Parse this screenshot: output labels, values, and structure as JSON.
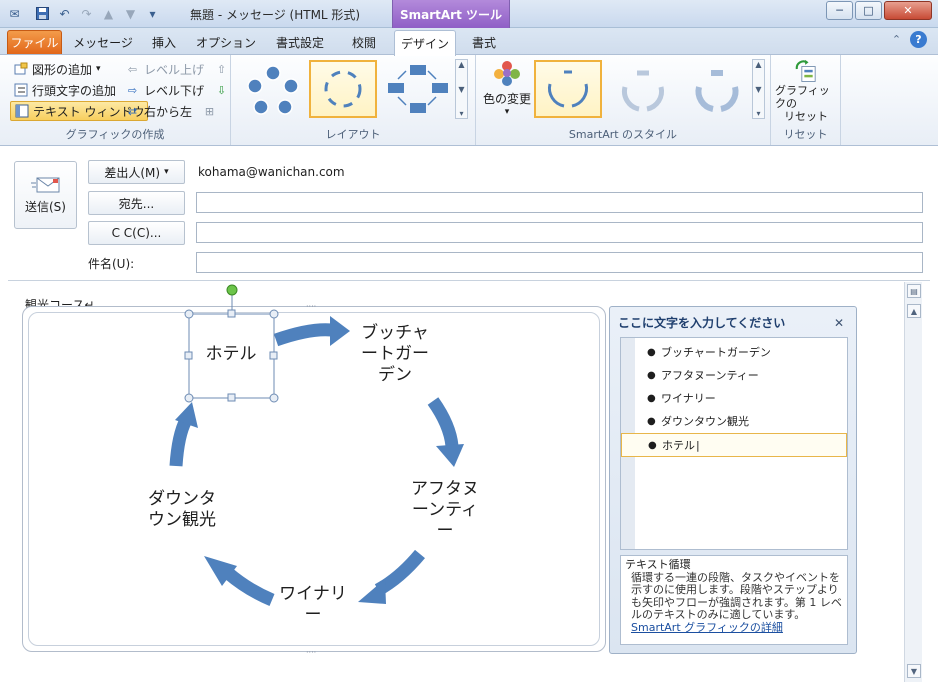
{
  "window": {
    "title": "無題 - メッセージ (HTML 形式)",
    "context_tab_header": "SmartArt ツール",
    "buttons": {
      "minimize": "─",
      "maximize": "□",
      "close": "✕"
    }
  },
  "ribbon_tabs": {
    "file": "ファイル",
    "message": "メッセージ",
    "insert": "挿入",
    "options": "オプション",
    "format_text": "書式設定",
    "review": "校閲",
    "design": "デザイン",
    "format": "書式"
  },
  "ribbon": {
    "create_graphic": {
      "label": "グラフィックの作成",
      "add_shape": "図形の追加",
      "add_bullet": "行頭文字の追加",
      "text_pane": "テキスト ウィンドウ",
      "promote": "レベル上げ",
      "demote": "レベル下げ",
      "right_to_left": "右から左"
    },
    "layout": {
      "label": "レイアウト"
    },
    "styles": {
      "label": "SmartArt のスタイル",
      "change_colors": "色の変更"
    },
    "reset": {
      "label": "リセット",
      "reset_graphic_line1": "グラフィックの",
      "reset_graphic_line2": "リセット"
    }
  },
  "mail": {
    "send": "送信(S)",
    "from_button": "差出人(M)",
    "from_value": "kohama@wanichan.com",
    "to_button": "宛先...",
    "cc_button": "C C(C)...",
    "subject_label": "件名(U):",
    "to_value": "",
    "cc_value": "",
    "subject_value": ""
  },
  "body": {
    "first_line": "観光コース↵"
  },
  "smartart": {
    "nodes": {
      "n1_line1": "ホテル",
      "n2_line1": "ブッチャ",
      "n2_line2": "ートガー",
      "n2_line3": "デン",
      "n3_line1": "アフタヌ",
      "n3_line2": "ーンティ",
      "n3_line3": "ー",
      "n4_line1": "ワイナリ",
      "n4_line2": "ー",
      "n5_line1": "ダウンタ",
      "n5_line2": "ウン観光"
    },
    "arrow_color": "#4f81bd"
  },
  "text_pane": {
    "title": "ここに文字を入力してください",
    "items": [
      "ブッチャートガーデン",
      "アフタヌーンティー",
      "ワイナリー",
      "ダウンタウン観光",
      "ホテル"
    ],
    "desc_title": "テキスト循環",
    "desc_body": "循環する一連の段階、タスクやイベントを示すのに使用します。段階やステップよりも矢印やフローが強調されます。第 1 レベルのテキストのみに適しています。",
    "desc_link": "SmartArt グラフィックの詳細"
  }
}
